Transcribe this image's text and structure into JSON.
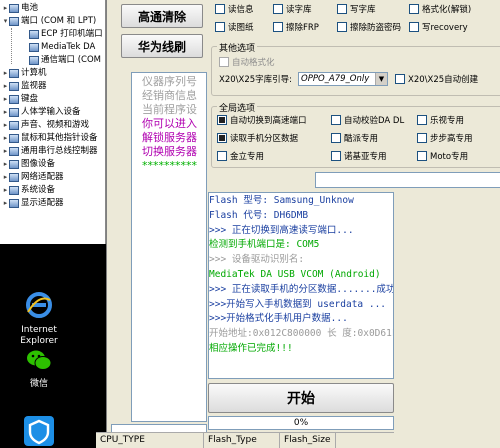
{
  "device_manager": {
    "items": [
      {
        "label": "电池",
        "indent": 0,
        "expander": "+"
      },
      {
        "label": "端口 (COM 和 LPT)",
        "indent": 0,
        "expander": "-"
      },
      {
        "label": "ECP 打印机端口",
        "indent": 1,
        "expander": ""
      },
      {
        "label": "MediaTek DA",
        "indent": 1,
        "expander": ""
      },
      {
        "label": "通信端口 (COM",
        "indent": 1,
        "expander": ""
      },
      {
        "label": "计算机",
        "indent": 0,
        "expander": "+"
      },
      {
        "label": "监视器",
        "indent": 0,
        "expander": "+"
      },
      {
        "label": "键盘",
        "indent": 0,
        "expander": "+"
      },
      {
        "label": "人体学输入设备",
        "indent": 0,
        "expander": "+"
      },
      {
        "label": "声音、视频和游戏",
        "indent": 0,
        "expander": "+"
      },
      {
        "label": "鼠标和其他指针设备",
        "indent": 0,
        "expander": "+"
      },
      {
        "label": "通用串行总线控制器",
        "indent": 0,
        "expander": "+"
      },
      {
        "label": "图像设备",
        "indent": 0,
        "expander": "+"
      },
      {
        "label": "网络适配器",
        "indent": 0,
        "expander": "+"
      },
      {
        "label": "系统设备",
        "indent": 0,
        "expander": "+"
      },
      {
        "label": "显示适配器",
        "indent": 0,
        "expander": "+"
      }
    ]
  },
  "desktop": {
    "icons": [
      {
        "label": "Internet\nExplorer"
      },
      {
        "label": "微信"
      },
      {
        "label": ""
      }
    ]
  },
  "tool": {
    "buttons": {
      "clear": "高通清除",
      "unlock": "华为线刷",
      "start": "开始"
    },
    "mid_log": [
      {
        "text": "仪器序列号",
        "style": "gray"
      },
      {
        "text": "经销商信息",
        "style": "gray"
      },
      {
        "text": "当前程序设",
        "style": "gray"
      },
      {
        "text": "你可以进入",
        "style": "purple"
      },
      {
        "text": "解锁服务器",
        "style": "purple"
      },
      {
        "text": "切换服务器",
        "style": "purple"
      },
      {
        "text": "**********",
        "style": "green"
      }
    ],
    "top_checks": [
      {
        "label": "读信息",
        "checked": false
      },
      {
        "label": "读字库",
        "checked": false
      },
      {
        "label": "写字库",
        "checked": false
      },
      {
        "label": "格式化(解锁)",
        "checked": false
      },
      {
        "label": "读图纸",
        "checked": false
      },
      {
        "label": "擦除FRP",
        "checked": false
      },
      {
        "label": "擦除防盗密码",
        "checked": false
      },
      {
        "label": "写recovery",
        "checked": false
      }
    ],
    "other_options": {
      "title": "其他选项",
      "auto_format": "自动格式化",
      "font_label": "X20\\X25字库引导:",
      "font_value": "OPPO_A79_Only",
      "auto_create": "X20\\X25自动创建"
    },
    "global_options": {
      "title": "全局选项",
      "items": [
        {
          "label": "自动切换到高速端口",
          "checked": true
        },
        {
          "label": "自动校验DA DL",
          "checked": false
        },
        {
          "label": "乐视专用",
          "checked": false
        },
        {
          "label": "读取手机分区数据",
          "checked": true
        },
        {
          "label": "酷派专用",
          "checked": false
        },
        {
          "label": "步步高专用",
          "checked": false
        },
        {
          "label": "金立专用",
          "checked": false
        },
        {
          "label": "诺基亚专用",
          "checked": false
        },
        {
          "label": "Moto专用",
          "checked": false
        }
      ]
    },
    "log": [
      {
        "text": "  Flash 型号: Samsung_Unknow",
        "color": "#1a3fa0"
      },
      {
        "text": "  Flash 代号: DH6DMB",
        "color": "#1a3fa0"
      },
      {
        "text": ">>> 正在切换到高速读写端口...",
        "color": "#1a3fa0"
      },
      {
        "text": "    检测到手机端口是:  COM5",
        "color": "#00a800"
      },
      {
        "text": ">>> 设备驱动识别名:",
        "color": "#9a9a9a"
      },
      {
        "text": "    MediaTek DA USB VCOM (Android)",
        "color": "#00a800"
      },
      {
        "text": ">>> 正在读取手机的分区数据.......成功",
        "color": "#1a3fa0"
      },
      {
        "text": ">>>开始写入手机数据到 userdata ...",
        "color": "#1a3fa0"
      },
      {
        "text": ">>>开始格式化手机用户数据...",
        "color": "#1a3fa0"
      },
      {
        "text": "    开始地址:0x012C800000   长   度:0x0D61FFBBC",
        "color": "#9a9a9a"
      },
      {
        "text": "    相应操作已完成!!!",
        "color": "#00a800"
      }
    ],
    "progress": {
      "value": 0,
      "text": "0%"
    },
    "status": {
      "cpu_type": "CPU_TYPE",
      "flash_type": "Flash_Type",
      "flash_size": "Flash_Size"
    }
  }
}
